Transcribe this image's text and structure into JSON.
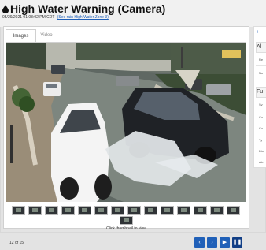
{
  "header": {
    "title": "High Water Warning (Camera)",
    "timestamp": "05/29/2021 01:08:02 PM CDT",
    "zone_link": "(See rain High Water Zone 3)"
  },
  "tabs": [
    {
      "label": "Images"
    },
    {
      "label": "Video"
    }
  ],
  "gallery": {
    "instruction": "Click thumbnail to view",
    "counter": "12 of 15",
    "controls": [
      "prev",
      "next",
      "play",
      "pause"
    ],
    "controls_glyphs": [
      "‹",
      "›",
      "▶",
      "❚❚"
    ]
  },
  "sidebar": {
    "toggle": "‹",
    "headings": [
      "Al",
      "Fu"
    ],
    "rows": [
      "Re",
      "No",
      "Sy",
      "Co",
      "Co",
      "Ty",
      "Dis",
      "Ale"
    ]
  },
  "colors": {
    "accent": "#2060b8",
    "active": "#123f86",
    "link": "#1f5fb8"
  },
  "icons": [
    "water-drop-icon",
    "chevron-left-icon",
    "chevron-right-icon",
    "play-icon",
    "pause-icon"
  ]
}
